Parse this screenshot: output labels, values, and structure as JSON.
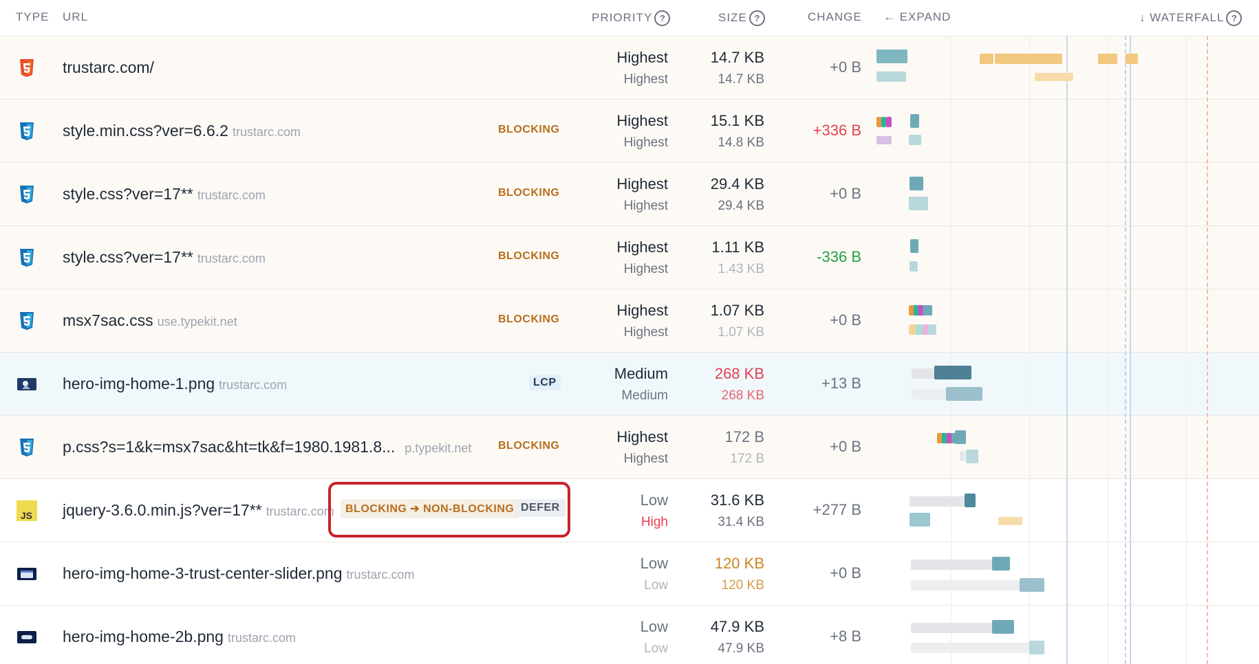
{
  "header": {
    "type": "TYPE",
    "url": "URL",
    "priority": "PRIORITY",
    "size": "SIZE",
    "change": "CHANGE",
    "expand": "← EXPAND",
    "waterfall": "↓ WATERFALL",
    "help_glyph": "?"
  },
  "rows": [
    {
      "type": "html",
      "url": "trustarc.com/",
      "host": "",
      "badge": "",
      "priority": "Highest",
      "priority_prev": "Highest",
      "size": "14.7 KB",
      "size_prev": "14.7 KB",
      "change": "+0 B"
    },
    {
      "type": "css",
      "url": "style.min.css?ver=6.6.2",
      "host": "trustarc.com",
      "badge": "BLOCKING",
      "priority": "Highest",
      "priority_prev": "Highest",
      "size": "15.1 KB",
      "size_prev": "14.8 KB",
      "change": "+336 B"
    },
    {
      "type": "css",
      "url": "style.css?ver=17**",
      "host": "trustarc.com",
      "badge": "BLOCKING",
      "priority": "Highest",
      "priority_prev": "Highest",
      "size": "29.4 KB",
      "size_prev": "29.4 KB",
      "change": "+0 B"
    },
    {
      "type": "css",
      "url": "style.css?ver=17**",
      "host": "trustarc.com",
      "badge": "BLOCKING",
      "priority": "Highest",
      "priority_prev": "Highest",
      "size": "1.11 KB",
      "size_prev": "1.43 KB",
      "change": "-336 B"
    },
    {
      "type": "css",
      "url": "msx7sac.css",
      "host": "use.typekit.net",
      "badge": "BLOCKING",
      "priority": "Highest",
      "priority_prev": "Highest",
      "size": "1.07 KB",
      "size_prev": "1.07 KB",
      "change": "+0 B"
    },
    {
      "type": "image",
      "url": "hero-img-home-1.png",
      "host": "trustarc.com",
      "badge": "LCP",
      "priority": "Medium",
      "priority_prev": "Medium",
      "size": "268 KB",
      "size_prev": "268 KB",
      "change": "+13 B"
    },
    {
      "type": "css",
      "url": "p.css?s=1&k=msx7sac&ht=tk&f=1980.1981.8...",
      "host": "p.typekit.net",
      "badge": "BLOCKING",
      "priority": "Highest",
      "priority_prev": "Highest",
      "size": "172 B",
      "size_prev": "172 B",
      "change": "+0 B"
    },
    {
      "type": "js",
      "url": "jquery-3.6.0.min.js?ver=17**",
      "host": "trustarc.com",
      "badge": "BLOCKING ➔ NON-BLOCKING",
      "badge2": "DEFER",
      "priority": "Low",
      "priority_prev": "High",
      "size": "31.6 KB",
      "size_prev": "31.4 KB",
      "change": "+277 B"
    },
    {
      "type": "image",
      "url": "hero-img-home-3-trust-center-slider.png",
      "host": "trustarc.com",
      "badge": "",
      "priority": "Low",
      "priority_prev": "Low",
      "size": "120 KB",
      "size_prev": "120 KB",
      "change": "+0 B"
    },
    {
      "type": "image",
      "url": "hero-img-home-2b.png",
      "host": "trustarc.com",
      "badge": "",
      "priority": "Low",
      "priority_prev": "Low",
      "size": "47.9 KB",
      "size_prev": "47.9 KB",
      "change": "+8 B"
    }
  ],
  "icons": {
    "html": "html5-icon",
    "css": "css3-icon",
    "js": "js-icon",
    "image": "image-thumbnail-icon",
    "js_text": "JS"
  },
  "colors": {
    "blocking": "#b76e1c",
    "increase": "#e53e4f",
    "decrease": "#22a046",
    "highlight": "#c8232c"
  }
}
